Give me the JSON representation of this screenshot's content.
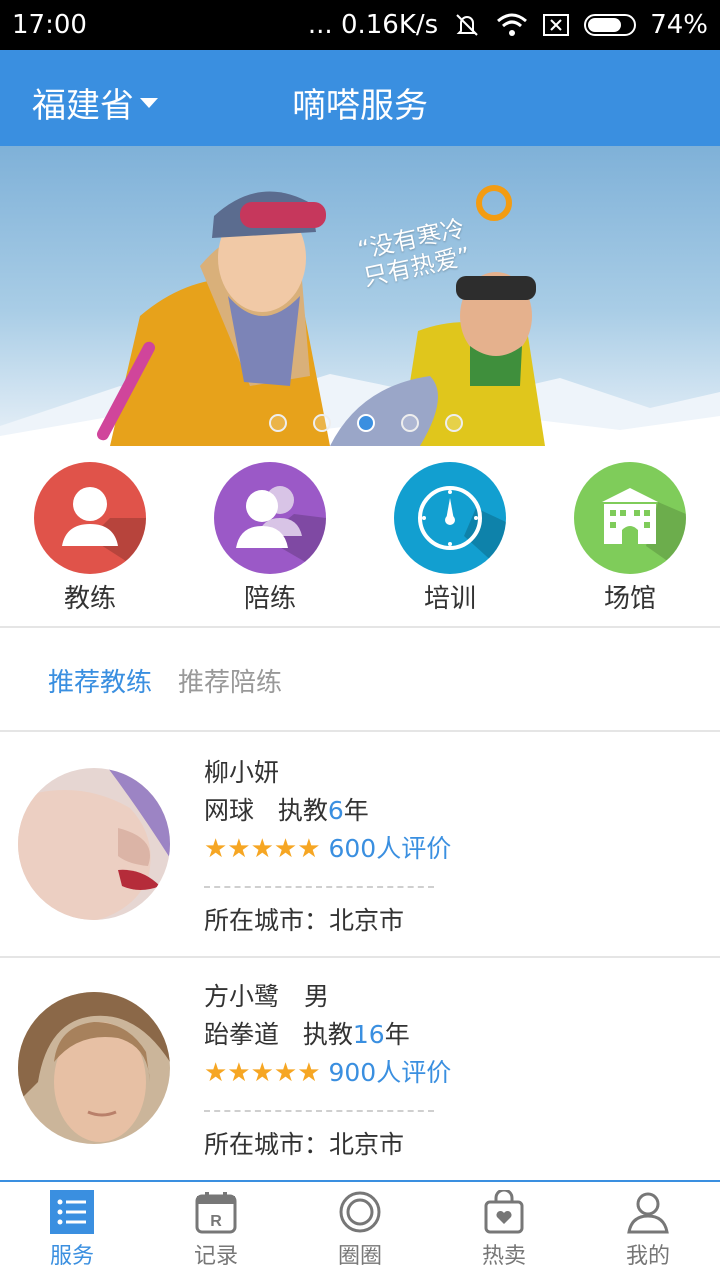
{
  "status_bar": {
    "time": "17:00",
    "speed": "... 0.16K/s",
    "battery": "74%",
    "battery_level": 0.74
  },
  "header": {
    "province": "福建省",
    "title": "嘀嗒服务"
  },
  "banner": {
    "slogan_line1": "“没有寒冷",
    "slogan_line2": "只有热爱”",
    "dots_count": 5,
    "active_dot": 3
  },
  "categories": [
    {
      "label": "教练",
      "icon": "person-icon",
      "color": "#e0534a"
    },
    {
      "label": "陪练",
      "icon": "two-persons-icon",
      "color": "#9b59c7"
    },
    {
      "label": "培训",
      "icon": "compass-icon",
      "color": "#129fd0"
    },
    {
      "label": "场馆",
      "icon": "building-icon",
      "color": "#7fcc5a"
    }
  ],
  "recommend_tabs": {
    "coach": "推荐教练",
    "partner": "推荐陪练",
    "active": "coach"
  },
  "coaches": [
    {
      "name": "柳小妍",
      "sport": "网球",
      "teach_prefix": "执教",
      "years": "6",
      "years_suffix": "年",
      "stars": "★★★★★",
      "rating": 5,
      "reviews": "600人评价",
      "city": "所在城市：北京市"
    },
    {
      "name": "方小鹭　男",
      "sport": "跆拳道",
      "teach_prefix": "执教",
      "years": "16",
      "years_suffix": "年",
      "stars": "★★★★★",
      "rating": 5,
      "reviews": "900人评价",
      "city": "所在城市：北京市"
    }
  ],
  "tabbar": [
    {
      "label": "服务",
      "icon": "list-icon",
      "active": true
    },
    {
      "label": "记录",
      "icon": "calendar-icon",
      "active": false
    },
    {
      "label": "圈圈",
      "icon": "circle-icon",
      "active": false
    },
    {
      "label": "热卖",
      "icon": "bag-icon",
      "active": false
    },
    {
      "label": "我的",
      "icon": "user-icon",
      "active": false
    }
  ],
  "colors": {
    "accent": "#3a8fe0",
    "star": "#f6a623"
  }
}
